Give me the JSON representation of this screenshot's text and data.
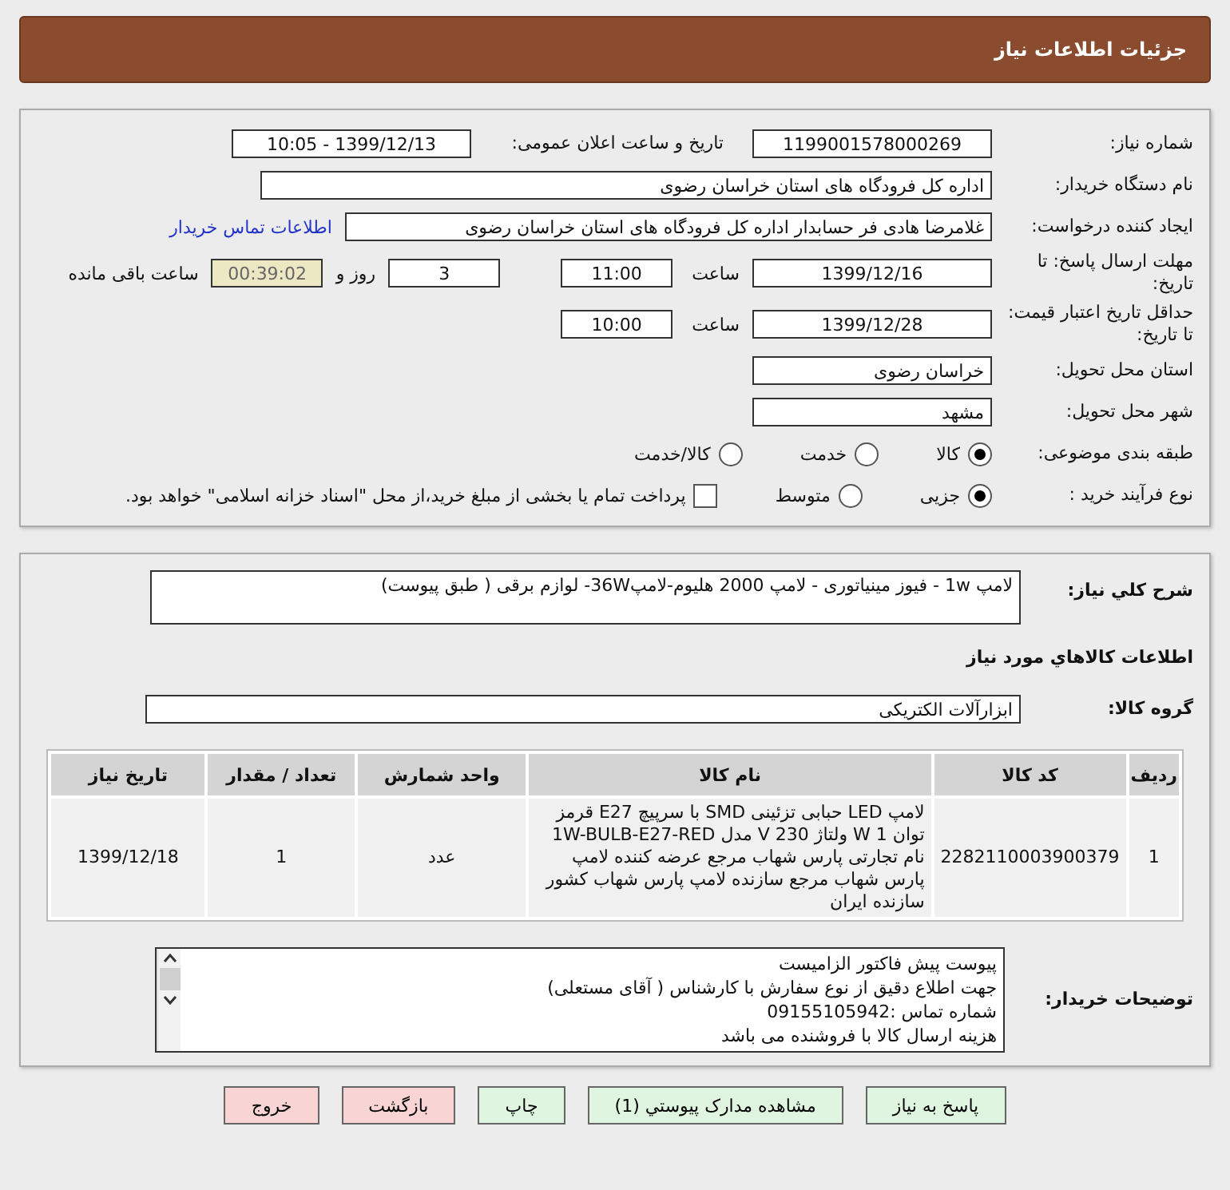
{
  "header": {
    "title": "جزئیات اطلاعات نیاز"
  },
  "details": {
    "need_number": {
      "label": "شماره نیاز:",
      "value": "1199001578000269"
    },
    "announce": {
      "label": "تاریخ و ساعت اعلان عمومی:",
      "value": "1399/12/13 - 10:05"
    },
    "buyer": {
      "label": "نام دستگاه خریدار:",
      "value": "اداره کل فرودگاه های استان خراسان رضوی"
    },
    "creator": {
      "label": "ایجاد کننده درخواست:",
      "value": "غلامرضا هادی فر حسابدار اداره کل فرودگاه های استان خراسان رضوی",
      "link": "اطلاعات تماس خریدار"
    },
    "deadline": {
      "label": "مهلت ارسال پاسخ: تا تاریخ:",
      "date": "1399/12/16",
      "time_label": "ساعت",
      "time": "11:00",
      "days": "3",
      "days_label": "روز و",
      "remaining": "00:39:02",
      "remaining_label": "ساعت باقی مانده"
    },
    "validity": {
      "label": "حداقل تاریخ اعتبار قیمت: تا تاریخ:",
      "date": "1399/12/28",
      "time_label": "ساعت",
      "time": "10:00"
    },
    "province": {
      "label": "استان محل تحویل:",
      "value": "خراسان رضوی"
    },
    "city": {
      "label": "شهر محل تحویل:",
      "value": "مشهد"
    },
    "category": {
      "label": "طبقه بندی موضوعی:",
      "options": [
        {
          "label": "کالا",
          "selected": true
        },
        {
          "label": "خدمت",
          "selected": false
        },
        {
          "label": "کالا/خدمت",
          "selected": false
        }
      ]
    },
    "process": {
      "label": "نوع فرآیند خرید :",
      "options": [
        {
          "label": "جزیی",
          "selected": true
        },
        {
          "label": "متوسط",
          "selected": false
        }
      ],
      "payment": {
        "label": "پرداخت تمام یا بخشی از مبلغ خرید،از محل \"اسناد خزانه اسلامی\" خواهد بود.",
        "checked": false
      }
    }
  },
  "need": {
    "description": {
      "label": "شرح کلي نياز:",
      "value": "لامپ 1w -  فیوز مینیاتوری - لامپ 2000 هلیوم-لامپ36W- لوازم برقی ( طبق پیوست)"
    },
    "goods_heading": "اطلاعات کالاهاي مورد نياز",
    "group": {
      "label": "گروه کالا:",
      "value": "ابزارآلات الکتریکی"
    },
    "table": {
      "columns": [
        "ردیف",
        "کد کالا",
        "نام کالا",
        "واحد شمارش",
        "تعداد / مقدار",
        "تاریخ نیاز"
      ],
      "rows": [
        [
          "1",
          "2282110003900379",
          "لامپ LED حبابی تزئینی SMD با سرپیچ E27 قرمز توان 1 W ولتاژ 230 V مدل 1W-BULB-E27-RED نام تجارتی پارس شهاب مرجع عرضه کننده لامپ پارس شهاب مرجع سازنده لامپ پارس شهاب کشور سازنده ایران",
          "عدد",
          "1",
          "1399/12/18"
        ]
      ]
    },
    "notes": {
      "label": "توضیحات خریدار:",
      "lines": [
        "پیوست پیش فاکتور الزامیست",
        "جهت اطلاع دقیق از نوع سفارش با کارشناس   ( آقای مستعلی)",
        "شماره تماس :09155105942",
        "هزینه ارسال کالا با فروشنده می باشد"
      ]
    }
  },
  "buttons": [
    {
      "label": "پاسخ به نیاز",
      "kind": "action"
    },
    {
      "label": "مشاهده مدارک پیوستي (1)",
      "kind": "action"
    },
    {
      "label": "چاپ",
      "kind": "action"
    },
    {
      "label": "بازگشت",
      "kind": "exit"
    },
    {
      "label": "خروج",
      "kind": "exit"
    }
  ]
}
